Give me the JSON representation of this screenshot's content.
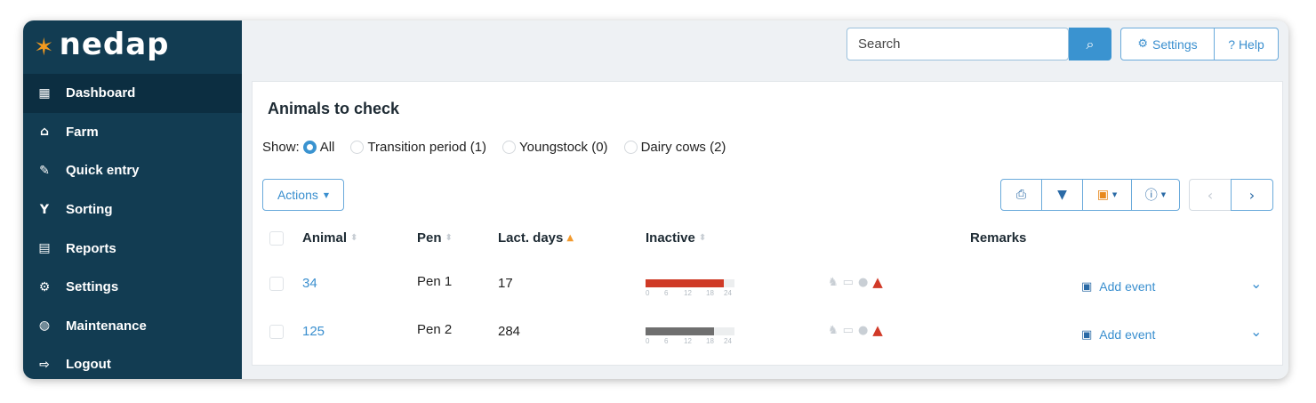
{
  "app": {
    "logo_text": "nedap"
  },
  "sidebar": {
    "items": [
      {
        "label": "Dashboard",
        "icon": "grid-icon",
        "glyph": "▦",
        "active": true
      },
      {
        "label": "Farm",
        "icon": "farm-icon",
        "glyph": "⌂"
      },
      {
        "label": "Quick entry",
        "icon": "edit-icon",
        "glyph": "✎"
      },
      {
        "label": "Sorting",
        "icon": "sorting-icon",
        "glyph": "Y"
      },
      {
        "label": "Reports",
        "icon": "report-icon",
        "glyph": "▤"
      },
      {
        "label": "Settings",
        "icon": "gear-icon",
        "glyph": "⚙"
      },
      {
        "label": "Maintenance",
        "icon": "shield-icon",
        "glyph": "◍"
      },
      {
        "label": "Logout",
        "icon": "logout-icon",
        "glyph": "⇨"
      }
    ]
  },
  "header": {
    "search_placeholder": "Search",
    "settings_label": "Settings",
    "help_label": "? Help"
  },
  "panel": {
    "title": "Animals to check",
    "show_label": "Show:",
    "filters": [
      {
        "label": "All",
        "selected": true
      },
      {
        "label": "Transition period (1)",
        "selected": false
      },
      {
        "label": "Youngstock (0)",
        "selected": false
      },
      {
        "label": "Dairy cows (2)",
        "selected": false
      }
    ],
    "actions_label": "Actions",
    "columns": {
      "animal": "Animal",
      "pen": "Pen",
      "lact_days": "Lact. days",
      "inactive": "Inactive",
      "remarks": "Remarks"
    },
    "bar_ticks": [
      "0",
      "6",
      "12",
      "18",
      "24"
    ],
    "rows": [
      {
        "animal": "34",
        "pen": "Pen 1",
        "lact_days": "17",
        "inactive_fraction": 0.88,
        "inactive_color": "#cf3a26",
        "add_event": "Add event"
      },
      {
        "animal": "125",
        "pen": "Pen 2",
        "lact_days": "284",
        "inactive_fraction": 0.77,
        "inactive_color": "#6f6f6f",
        "add_event": "Add event"
      }
    ]
  },
  "colors": {
    "sidebar": "#123c52",
    "accent": "#3a93d0",
    "warning": "#d13a28",
    "sort_active": "#f29a2e"
  }
}
